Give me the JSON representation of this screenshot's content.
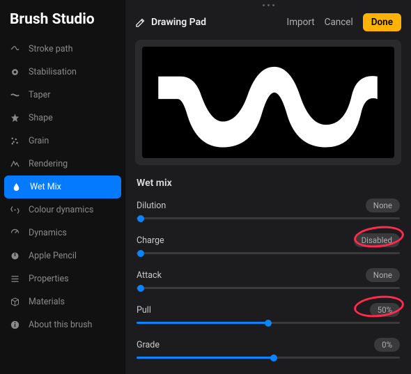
{
  "app_title": "Brush Studio",
  "sidebar": {
    "items": [
      {
        "label": "Stroke path",
        "icon": "stroke-path"
      },
      {
        "label": "Stabilisation",
        "icon": "stabilisation"
      },
      {
        "label": "Taper",
        "icon": "taper"
      },
      {
        "label": "Shape",
        "icon": "shape"
      },
      {
        "label": "Grain",
        "icon": "grain"
      },
      {
        "label": "Rendering",
        "icon": "rendering"
      },
      {
        "label": "Wet Mix",
        "icon": "wetmix",
        "selected": true
      },
      {
        "label": "Colour dynamics",
        "icon": "colourdyn"
      },
      {
        "label": "Dynamics",
        "icon": "dynamics"
      },
      {
        "label": "Apple Pencil",
        "icon": "applepencil"
      },
      {
        "label": "Properties",
        "icon": "properties"
      },
      {
        "label": "Materials",
        "icon": "materials"
      },
      {
        "label": "About this brush",
        "icon": "about"
      }
    ]
  },
  "header": {
    "pad_label": "Drawing Pad",
    "import": "Import",
    "cancel": "Cancel",
    "done": "Done"
  },
  "section": {
    "title": "Wet mix",
    "sliders": [
      {
        "label": "Dilution",
        "value_text": "None",
        "pct": 0,
        "highlight": false
      },
      {
        "label": "Charge",
        "value_text": "Disabled",
        "pct": 0,
        "highlight": true
      },
      {
        "label": "Attack",
        "value_text": "None",
        "pct": 0,
        "highlight": false
      },
      {
        "label": "Pull",
        "value_text": "50%",
        "pct": 50,
        "highlight": true
      },
      {
        "label": "Grade",
        "value_text": "0%",
        "pct": 52,
        "highlight": false
      }
    ]
  }
}
